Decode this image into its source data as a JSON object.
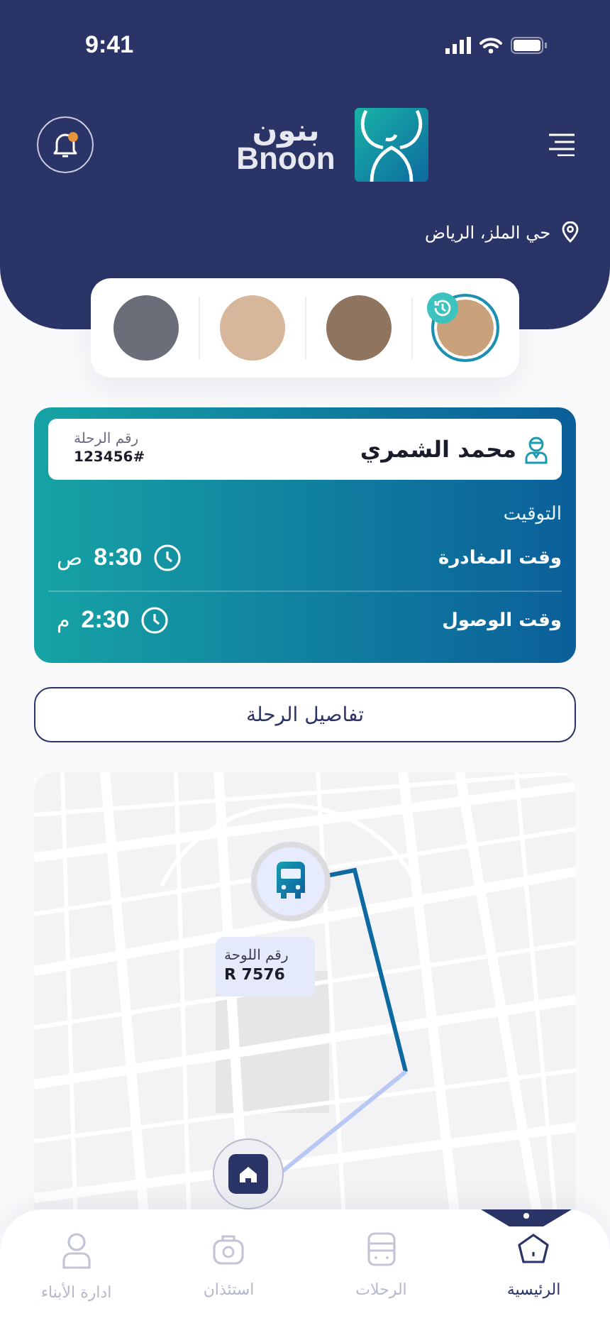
{
  "status_bar": {
    "time": "9:41"
  },
  "header": {
    "brand_arabic": "بنون",
    "brand_latin": "Bnoon",
    "notification_unread": true,
    "location": "حي الملز، الرياض"
  },
  "children": [
    {
      "selected": true
    },
    {
      "selected": false
    },
    {
      "selected": false
    },
    {
      "selected": false
    }
  ],
  "trip": {
    "driver_name": "محمد الشمري",
    "trip_number_label": "رقم الرحلة",
    "trip_number": "123456#",
    "timing_label": "التوقيت",
    "times": [
      {
        "label": "وقت المغادرة",
        "time": "8:30",
        "period": "ص"
      },
      {
        "label": "وقت الوصول",
        "time": "2:30",
        "period": "م"
      }
    ]
  },
  "details_button": "تفاصيل الرحلة",
  "map": {
    "plate_label": "رقم اللوحة",
    "plate_number": "R 7576"
  },
  "nav": [
    {
      "kind": "home",
      "label": "الرئيسية",
      "selected": true
    },
    {
      "kind": "trips",
      "label": "الرحلات",
      "selected": false
    },
    {
      "kind": "permission",
      "label": "استئذان",
      "selected": false
    },
    {
      "kind": "children",
      "label": "ادارة الأبناء",
      "selected": false
    }
  ]
}
